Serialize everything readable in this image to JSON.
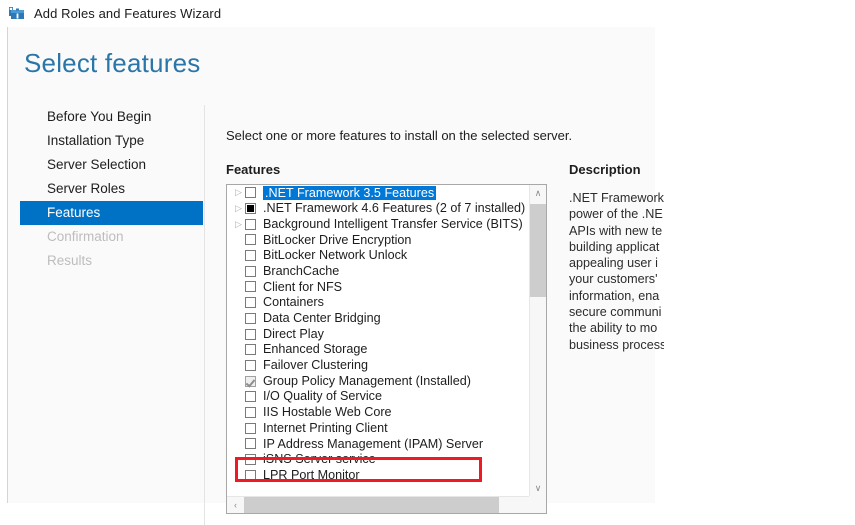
{
  "window": {
    "title": "Add Roles and Features Wizard",
    "icon": "toolbox-icon"
  },
  "page": {
    "heading": "Select features",
    "intro": "Select one or more features to install on the selected server.",
    "features_label": "Features"
  },
  "nav": {
    "items": [
      {
        "label": "Before You Begin",
        "state": "normal"
      },
      {
        "label": "Installation Type",
        "state": "normal"
      },
      {
        "label": "Server Selection",
        "state": "normal"
      },
      {
        "label": "Server Roles",
        "state": "normal"
      },
      {
        "label": "Features",
        "state": "selected"
      },
      {
        "label": "Confirmation",
        "state": "disabled"
      },
      {
        "label": "Results",
        "state": "disabled"
      }
    ]
  },
  "features_list": {
    "items": [
      {
        "label": ".NET Framework 3.5 Features",
        "expander": "▷",
        "checkbox": "unchecked",
        "selected": true
      },
      {
        "label": ".NET Framework 4.6 Features (2 of 7 installed)",
        "expander": "▷",
        "checkbox": "partial",
        "selected": false
      },
      {
        "label": "Background Intelligent Transfer Service (BITS)",
        "expander": "▷",
        "checkbox": "unchecked",
        "selected": false
      },
      {
        "label": "BitLocker Drive Encryption",
        "expander": "",
        "checkbox": "unchecked",
        "selected": false
      },
      {
        "label": "BitLocker Network Unlock",
        "expander": "",
        "checkbox": "unchecked",
        "selected": false
      },
      {
        "label": "BranchCache",
        "expander": "",
        "checkbox": "unchecked",
        "selected": false
      },
      {
        "label": "Client for NFS",
        "expander": "",
        "checkbox": "unchecked",
        "selected": false
      },
      {
        "label": "Containers",
        "expander": "",
        "checkbox": "unchecked",
        "selected": false
      },
      {
        "label": "Data Center Bridging",
        "expander": "",
        "checkbox": "unchecked",
        "selected": false
      },
      {
        "label": "Direct Play",
        "expander": "",
        "checkbox": "unchecked",
        "selected": false
      },
      {
        "label": "Enhanced Storage",
        "expander": "",
        "checkbox": "unchecked",
        "selected": false
      },
      {
        "label": "Failover Clustering",
        "expander": "",
        "checkbox": "unchecked",
        "selected": false
      },
      {
        "label": "Group Policy Management (Installed)",
        "expander": "",
        "checkbox": "installed",
        "selected": false
      },
      {
        "label": "I/O Quality of Service",
        "expander": "",
        "checkbox": "unchecked",
        "selected": false
      },
      {
        "label": "IIS Hostable Web Core",
        "expander": "",
        "checkbox": "unchecked",
        "selected": false
      },
      {
        "label": "Internet Printing Client",
        "expander": "",
        "checkbox": "unchecked",
        "selected": false
      },
      {
        "label": "IP Address Management (IPAM) Server",
        "expander": "",
        "checkbox": "unchecked",
        "selected": false
      },
      {
        "label": "iSNS Server service",
        "expander": "",
        "checkbox": "unchecked",
        "selected": false
      },
      {
        "label": "LPR Port Monitor",
        "expander": "",
        "checkbox": "unchecked",
        "selected": false
      }
    ],
    "vscroll": {
      "up_glyph": "∧",
      "down_glyph": "∨"
    },
    "hscroll": {
      "left_glyph": "‹",
      "right_glyph": "›"
    }
  },
  "description": {
    "title": "Description",
    "body": ".NET Framework\npower of the .NE\nAPIs with new te\nbuilding applicat\nappealing user i\nyour customers'\ninformation, ena\nsecure communi\nthe ability to mo\nbusiness process"
  },
  "annotation": {
    "highlight_color": "#ee1b24",
    "highlights_row": "Group Policy Management (Installed)"
  },
  "colors": {
    "accent": "#0072c6",
    "heading": "#2a76a8",
    "selection": "#0078d7",
    "panel_bg": "#fafafa"
  }
}
